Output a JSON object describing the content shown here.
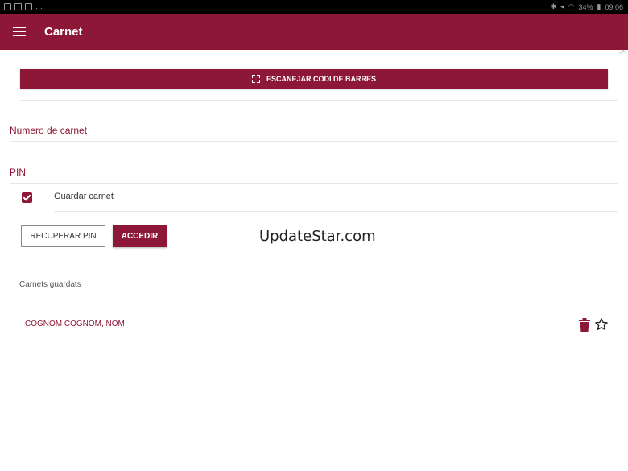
{
  "status_bar": {
    "battery": "34%",
    "time": "09:06"
  },
  "app_bar": {
    "title": "Carnet",
    "menu_icon": "menu-icon"
  },
  "scan_button": {
    "label": "ESCANEJAR CODI DE BARRES",
    "icon": "scan-barcode-icon"
  },
  "form": {
    "card_number_label": "Numero de carnet",
    "card_number_value": "",
    "pin_label": "PIN",
    "pin_value": "",
    "save_card_label": "Guardar carnet",
    "save_card_checked": true
  },
  "actions": {
    "recover_pin": "RECUPERAR PIN",
    "login": "ACCEDIR"
  },
  "watermark": "UpdateStar.com",
  "saved_cards": {
    "title": "Carnets guardats",
    "items": [
      {
        "name": "COGNOM COGNOM, NOM",
        "delete_icon": "trash-icon",
        "favorite_icon": "star-outline-icon"
      }
    ]
  },
  "colors": {
    "primary": "#8c1736",
    "text": "#333333",
    "divider": "#e6e6e6"
  }
}
